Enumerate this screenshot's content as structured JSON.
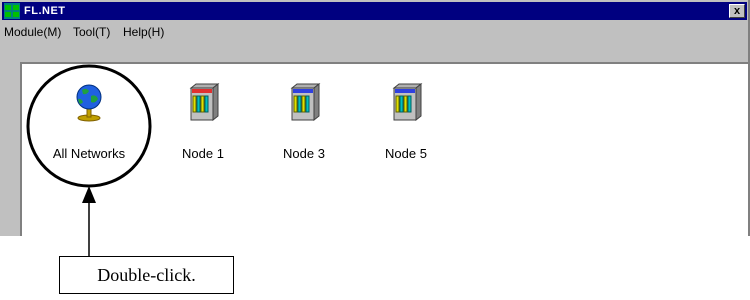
{
  "window": {
    "title": "FL.NET",
    "close_label": "x"
  },
  "menu": [
    {
      "label": "Module(M)"
    },
    {
      "label": "Tool(T)"
    },
    {
      "label": "Help(H)"
    }
  ],
  "nodes": [
    {
      "label": "All Networks",
      "icon": "globe-icon"
    },
    {
      "label": "Node 1",
      "icon": "node-device-icon"
    },
    {
      "label": "Node 3",
      "icon": "node-device-icon"
    },
    {
      "label": "Node 5",
      "icon": "node-device-icon"
    }
  ],
  "annotation": {
    "callout_text": "Double-click."
  }
}
